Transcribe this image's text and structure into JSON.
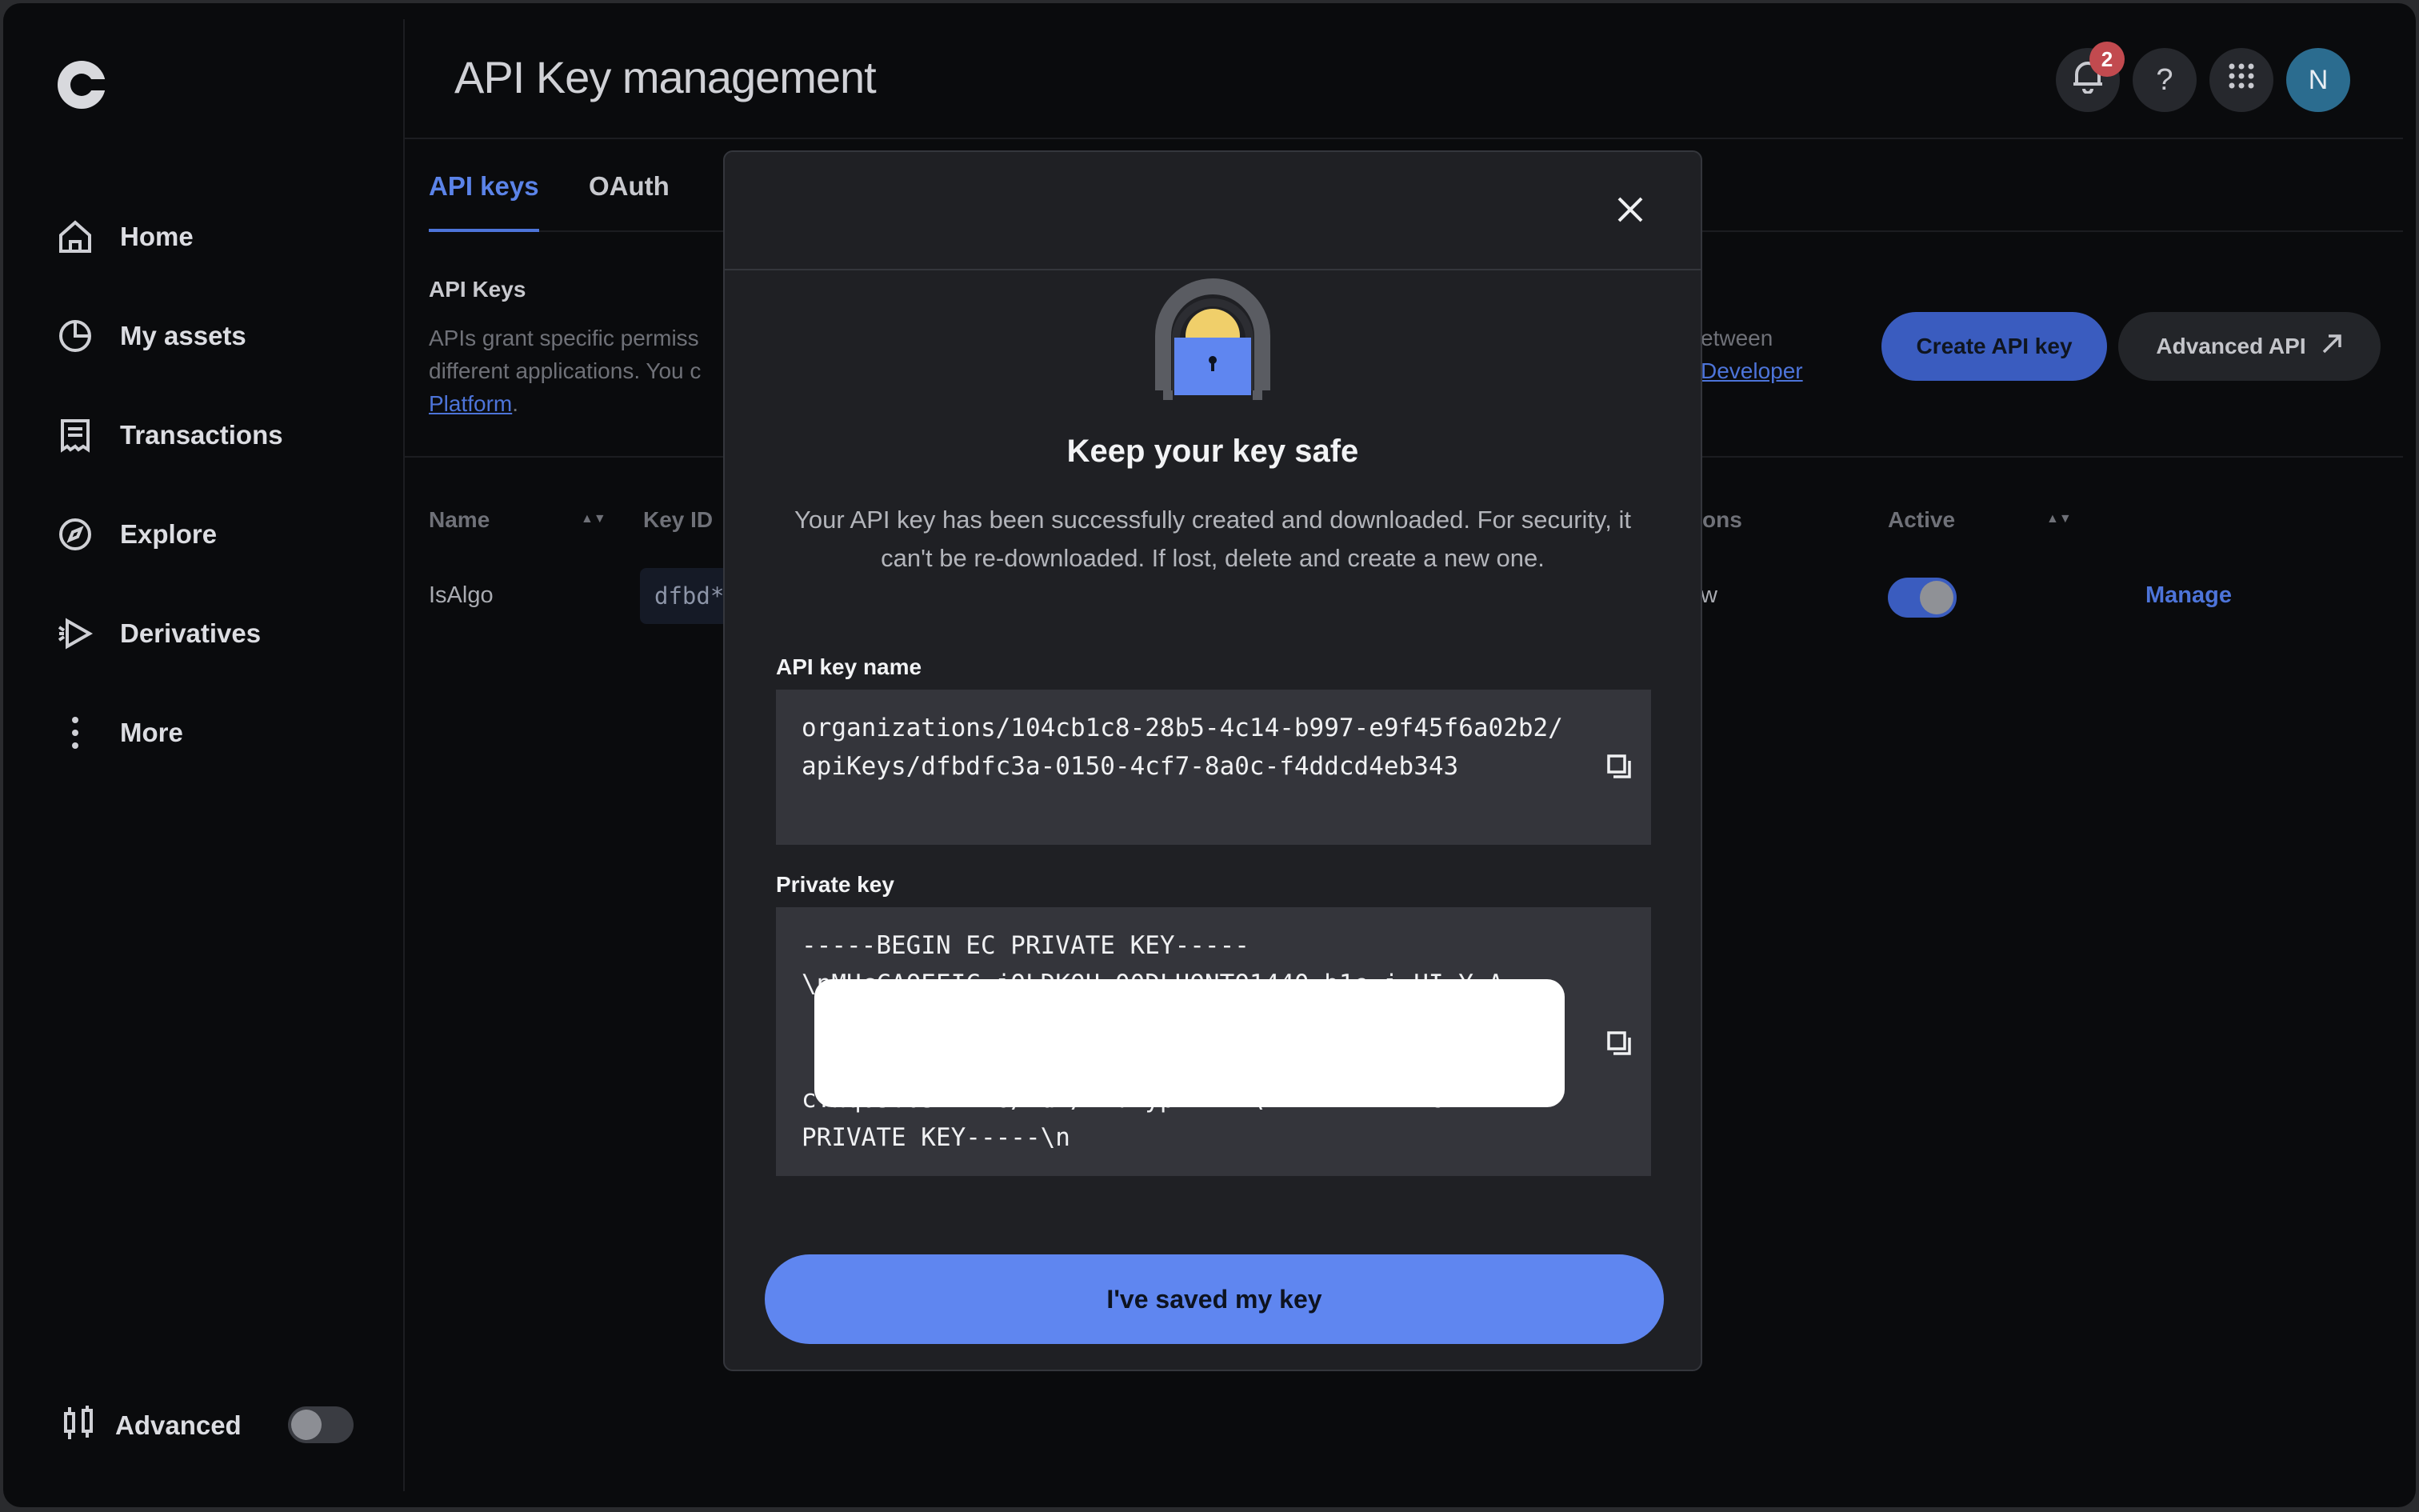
{
  "page": {
    "title": "API Key management"
  },
  "sidebar": {
    "items": [
      {
        "label": "Home"
      },
      {
        "label": "My assets"
      },
      {
        "label": "Transactions"
      },
      {
        "label": "Explore"
      },
      {
        "label": "Derivatives"
      },
      {
        "label": "More"
      }
    ],
    "advanced_label": "Advanced"
  },
  "header": {
    "notification_count": "2",
    "help_label": "?",
    "avatar_initial": "N"
  },
  "tabs": [
    {
      "label": "API keys"
    },
    {
      "label": "OAuth"
    }
  ],
  "section": {
    "title": "API Keys",
    "desc_visible": "APIs grant specific permiss",
    "desc_line2": "different applications. You c",
    "desc_link": "Platform",
    "desc_right_line1": "etween",
    "desc_right_link": "Developer",
    "create_button": "Create API key",
    "advanced_button": "Advanced API"
  },
  "table": {
    "headers": [
      "Name",
      "Key ID",
      "ons",
      "Active"
    ],
    "row": {
      "name": "IsAlgo",
      "key_id": "dfbd*",
      "permission_partial": "w",
      "manage": "Manage"
    }
  },
  "modal": {
    "title": "Keep your key safe",
    "description": "Your API key has been successfully created and downloaded. For security, it can't be re-downloaded. If lost, delete and create a new one.",
    "name_label": "API key name",
    "name_value": "organizations/104cb1c8-28b5-4c14-b997-e9f45f6a02b2/apiKeys/dfbdfc3a-0150-4cf7-8a0c-f4ddcd4eb343",
    "private_label": "Private key",
    "private_line1": "-----BEGIN EC PRIVATE KEY-----",
    "private_line_partial": "\\nMHcCAQEEIC jOLDKOU 00DLUONTO1440 b1e i HI Y A",
    "private_line_partial2": "cYhq05T05V+EW6/1dD/1Ff ypKwA==\\n-----END EC",
    "private_line_last": "PRIVATE KEY-----\\n",
    "saved_button": "I've saved my key"
  },
  "colors": {
    "accent": "#5f86f0",
    "background": "#0a0b0d",
    "modal": "#1f2024"
  }
}
